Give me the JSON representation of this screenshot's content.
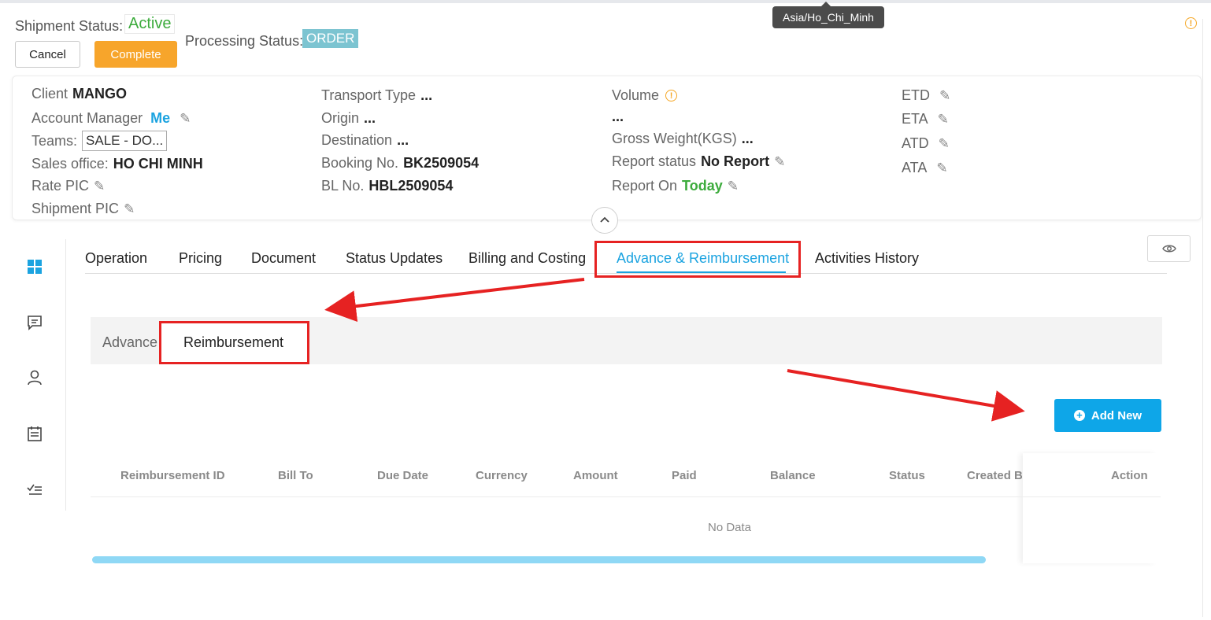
{
  "header": {
    "shipment_status_label": "Shipment Status:",
    "shipment_status_value": "Active",
    "processing_status_label": "Processing Status:",
    "processing_status_value": "ORDER",
    "cancel_label": "Cancel",
    "complete_label": "Complete",
    "timezone_tooltip": "Asia/Ho_Chi_Minh"
  },
  "info": {
    "client_label": "Client",
    "client_value": "MANGO",
    "account_manager_label": "Account Manager",
    "account_manager_value": "Me",
    "teams_label": "Teams:",
    "teams_value": "SALE - DO...",
    "sales_office_label": "Sales office:",
    "sales_office_value": "HO CHI MINH",
    "rate_pic_label": "Rate PIC",
    "shipment_pic_label": "Shipment PIC",
    "transport_type_label": "Transport Type",
    "transport_type_value": "...",
    "origin_label": "Origin",
    "origin_value": "...",
    "destination_label": "Destination",
    "destination_value": "...",
    "booking_no_label": "Booking No.",
    "booking_no_value": "BK2509054",
    "bl_no_label": "BL No.",
    "bl_no_value": "HBL2509054",
    "volume_label": "Volume",
    "volume_value": "...",
    "gross_weight_label": "Gross Weight(KGS)",
    "gross_weight_value": "...",
    "report_status_label": "Report status",
    "report_status_value": "No Report",
    "report_on_label": "Report On",
    "report_on_value": "Today",
    "etd_label": "ETD",
    "eta_label": "ETA",
    "atd_label": "ATD",
    "ata_label": "ATA"
  },
  "tabs": [
    {
      "label": "Operation"
    },
    {
      "label": "Pricing"
    },
    {
      "label": "Document"
    },
    {
      "label": "Status Updates"
    },
    {
      "label": "Billing and Costing"
    },
    {
      "label": "Advance & Reimbursement"
    },
    {
      "label": "Activities History"
    }
  ],
  "subtabs": [
    {
      "label": "Advance"
    },
    {
      "label": "Reimbursement"
    }
  ],
  "add_new_label": "Add New",
  "table": {
    "columns": [
      "Reimbursement ID",
      "Bill To",
      "Due Date",
      "Currency",
      "Amount",
      "Paid",
      "Balance",
      "Status",
      "Created B",
      "Action"
    ],
    "empty_text": "No Data"
  },
  "icons": {
    "sidebar": [
      "dashboard-icon",
      "chat-icon",
      "user-icon",
      "calendar-icon",
      "checklist-icon"
    ]
  },
  "colors": {
    "accent": "#1ba3e0",
    "complete": "#f7a52b",
    "active_status": "#3cab3c",
    "annotation": "#e62222"
  }
}
